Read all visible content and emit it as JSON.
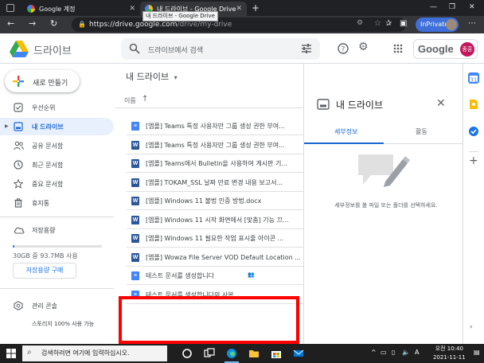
{
  "browser": {
    "tabs": [
      {
        "title": "Google 계정"
      },
      {
        "title": "내 드라이브 - Google Drive"
      }
    ],
    "tooltip": "내 드라이브 - Google Drive",
    "url_host": "https://drive.google.com",
    "url_path": "/drive/my-drive",
    "inprivate_label": "InPrivate"
  },
  "header": {
    "brand": "드라이브",
    "search_placeholder": "드라이브에서 검색",
    "google_word": "Google",
    "avatar_text": "종훈"
  },
  "sidebar": {
    "new_button": "새로 만들기",
    "items": [
      {
        "label": "우선순위",
        "icon": "check-circle-icon"
      },
      {
        "label": "내 드라이브",
        "icon": "my-drive-icon"
      },
      {
        "label": "공유 문서함",
        "icon": "people-icon"
      },
      {
        "label": "최근 문서함",
        "icon": "clock-icon"
      },
      {
        "label": "중요 문서함",
        "icon": "star-icon"
      },
      {
        "label": "휴지통",
        "icon": "trash-icon"
      }
    ],
    "storage_label": "저장용량",
    "storage_used": "30GB 중 93.7MB 사용",
    "storage_fraction": 0.003,
    "buy_storage": "저장용량 구매",
    "admin_console": "관리 콘솔",
    "storage_percent_text": "스토리지 100% 사용 가능"
  },
  "main": {
    "title": "내 드라이브",
    "column_name": "이름",
    "files": [
      {
        "name": "[엠플] Teams 특정 사용자만 그룹 생성 권한 부여...",
        "type": "doc",
        "shared": ""
      },
      {
        "name": "[엠플] Teams 특정 사용자만 그룹 생성 권한 부여...",
        "type": "word",
        "shared": ""
      },
      {
        "name": "[엠플] Teams에서 Bulletin을 사용하여 게시판 기...",
        "type": "word",
        "shared": ""
      },
      {
        "name": "[엠플] TOKAM_SSL 날짜 만료 변경 내용 보고서...",
        "type": "word",
        "shared": ""
      },
      {
        "name": "[엠플] Windows 11 불법 인증 방법.docx",
        "type": "word",
        "shared": ""
      },
      {
        "name": "[엠플] Windows 11 시작 화면에서 [맞춤] 기능 끄...",
        "type": "word",
        "shared": ""
      },
      {
        "name": "[엠플] Windows 11 필요한 작업 표시줄 아이콘 ...",
        "type": "word",
        "shared": ""
      },
      {
        "name": "[엠플] Wowza File Server VOD Default Location ...",
        "type": "word",
        "shared": ""
      },
      {
        "name": "테스트 문서를 생성합니다",
        "type": "doc",
        "shared": "👥"
      },
      {
        "name": "테스트 문서를 생성합니다의 사본",
        "type": "doc",
        "shared": ""
      }
    ]
  },
  "details": {
    "title": "내 드라이브",
    "tab_details": "세부정보",
    "tab_activity": "활동",
    "empty_text": "세부정보를 볼 파일 또는 폴더를 선택하세요."
  },
  "taskbar": {
    "search_text": "검색하려면 여기에 입력하십시오.",
    "ime": "A",
    "time": "오전 10:40",
    "date": "2021-11-11"
  },
  "colors": {
    "accent": "#1a73e8",
    "doc_blue": "#4285f4",
    "word_blue": "#2b579a",
    "highlight_red": "#ff0000"
  }
}
